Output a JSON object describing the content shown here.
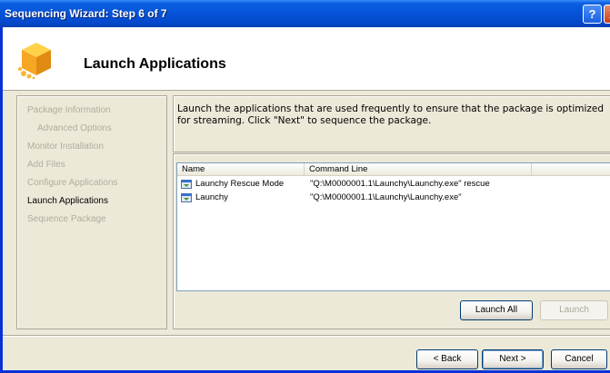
{
  "window": {
    "title": "Sequencing Wizard: Step 6 of 7",
    "help_label": "?",
    "close_label": "X"
  },
  "header": {
    "title": "Launch Applications",
    "icon": "package-boxes-icon"
  },
  "steps": [
    {
      "label": "Package Information",
      "state": "done"
    },
    {
      "label": "Advanced Options",
      "state": "done",
      "sub": true
    },
    {
      "label": "Monitor Installation",
      "state": "done"
    },
    {
      "label": "Add Files",
      "state": "done"
    },
    {
      "label": "Configure Applications",
      "state": "done"
    },
    {
      "label": "Launch Applications",
      "state": "current"
    },
    {
      "label": "Sequence Package",
      "state": "pending"
    }
  ],
  "description": "Launch the applications that are used frequently to ensure that the package is optimized for streaming. Click \"Next\" to sequence the package.",
  "list": {
    "columns": [
      "Name",
      "Command Line",
      ""
    ],
    "rows": [
      {
        "name": "Launchy Rescue Mode",
        "command": "\"Q:\\M0000001.1\\Launchy\\Launchy.exe\" rescue",
        "icon": "application-icon"
      },
      {
        "name": "Launchy",
        "command": "\"Q:\\M0000001.1\\Launchy\\Launchy.exe\"",
        "icon": "application-icon"
      }
    ]
  },
  "buttons": {
    "launch_all": "Launch All",
    "launch": "Launch",
    "back": "< Back",
    "next": "Next >",
    "cancel": "Cancel"
  },
  "colors": {
    "titlebar": "#0653d8",
    "frame": "#0831d9",
    "background": "#ece9d8"
  }
}
